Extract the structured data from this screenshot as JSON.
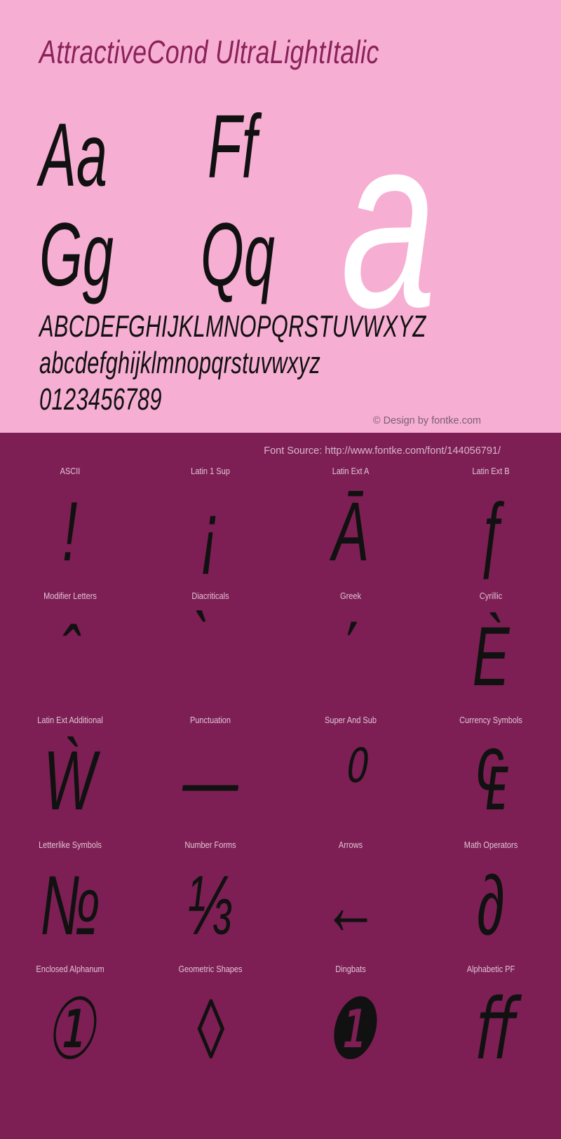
{
  "title": "AttractiveCond UltraLightItalic",
  "showcase": {
    "pairs": [
      "Aa",
      "Ff",
      "Gg",
      "Qq"
    ],
    "big_letter": "a"
  },
  "alphabet": {
    "uppercase": "ABCDEFGHIJKLMNOPQRSTUVWXYZ",
    "lowercase": "abcdefghijklmnopqrstuvwxyz",
    "digits": "0123456789"
  },
  "credits": {
    "copyright": "© Design by fontke.com",
    "font_source": "Font Source: http://www.fontke.com/font/144056791/"
  },
  "colors": {
    "top_background": "#f7aed3",
    "bottom_background": "#7d1f54",
    "title": "#8a2259",
    "glyph": "#111111",
    "big_letter": "#ffffff",
    "label": "#e2c3d5"
  },
  "unicode_blocks": [
    {
      "label": "ASCII",
      "glyph": "!"
    },
    {
      "label": "Latin 1 Sup",
      "glyph": "¡"
    },
    {
      "label": "Latin Ext A",
      "glyph": "Ā"
    },
    {
      "label": "Latin Ext B",
      "glyph": "ƒ"
    },
    {
      "label": "Modifier Letters",
      "glyph": "ˆ"
    },
    {
      "label": "Diacriticals",
      "glyph": "̀"
    },
    {
      "label": "Greek",
      "glyph": "΄"
    },
    {
      "label": "Cyrillic",
      "glyph": "Ѐ"
    },
    {
      "label": "Latin Ext Additional",
      "glyph": "Ẁ"
    },
    {
      "label": "Punctuation",
      "glyph": "—"
    },
    {
      "label": "Super And Sub",
      "glyph": "⁰"
    },
    {
      "label": "Currency Symbols",
      "glyph": "₠"
    },
    {
      "label": "Letterlike Symbols",
      "glyph": "№"
    },
    {
      "label": "Number Forms",
      "glyph": "⅓"
    },
    {
      "label": "Arrows",
      "glyph": "←"
    },
    {
      "label": "Math Operators",
      "glyph": "∂"
    },
    {
      "label": "Enclosed Alphanum",
      "glyph": "①"
    },
    {
      "label": "Geometric Shapes",
      "glyph": "◊"
    },
    {
      "label": "Dingbats",
      "glyph": "❶"
    },
    {
      "label": "Alphabetic PF",
      "glyph": "ﬀ"
    }
  ]
}
